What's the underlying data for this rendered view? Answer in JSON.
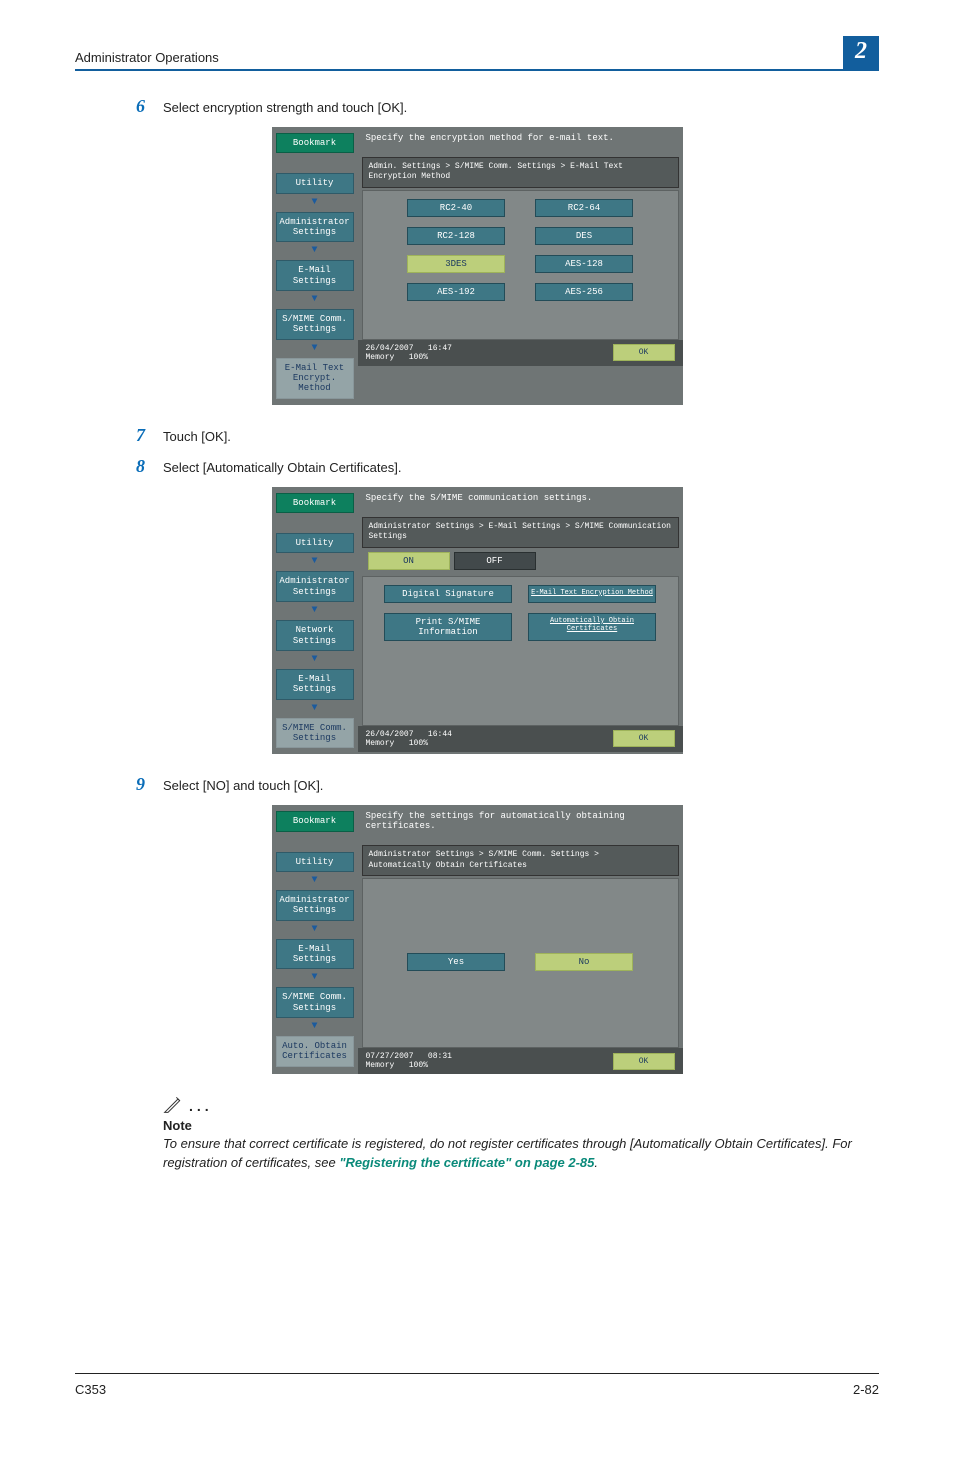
{
  "header": {
    "title": "Administrator Operations",
    "chapter_num": "2"
  },
  "steps": [
    {
      "num": "6",
      "text": "Select encryption strength and touch [OK]."
    },
    {
      "num": "7",
      "text": "Touch [OK]."
    },
    {
      "num": "8",
      "text": "Select [Automatically Obtain Certificates]."
    },
    {
      "num": "9",
      "text": "Select [NO] and touch [OK]."
    }
  ],
  "panel1": {
    "instruction": "Specify the encryption method for e-mail text.",
    "breadcrumb": "Admin. Settings > S/MIME Comm. Settings > E-Mail Text Encryption Method",
    "sidebar": {
      "bookmark": "Bookmark",
      "items": [
        "Utility",
        "Administrator Settings",
        "E-Mail Settings",
        "S/MIME Comm. Settings"
      ],
      "active": "E-Mail Text Encrypt. Method"
    },
    "options_rows": [
      [
        "RC2-40",
        "RC2-64"
      ],
      [
        "RC2-128",
        "DES"
      ],
      [
        "3DES",
        "AES-128"
      ],
      [
        "AES-192",
        "AES-256"
      ]
    ],
    "selected_row": 2,
    "selected_col": 0,
    "footer": {
      "date": "26/04/2007",
      "time": "16:47",
      "mem_label": "Memory",
      "mem_val": "100%",
      "ok": "OK"
    }
  },
  "panel2": {
    "instruction": "Specify the S/MIME communication settings.",
    "breadcrumb": "Administrator Settings > E-Mail Settings > S/MIME Communication Settings",
    "sidebar": {
      "bookmark": "Bookmark",
      "items": [
        "Utility",
        "Administrator Settings",
        "Network Settings",
        "E-Mail Settings"
      ],
      "active": "S/MIME Comm. Settings"
    },
    "onoff": {
      "on": "ON",
      "off": "OFF"
    },
    "pairs": [
      {
        "left": "Digital Signature",
        "right": "E-Mail Text Encryption Method"
      },
      {
        "left": "Print S/MIME Information",
        "right": "Automatically Obtain Certificates"
      }
    ],
    "footer": {
      "date": "26/04/2007",
      "time": "16:44",
      "mem_label": "Memory",
      "mem_val": "100%",
      "ok": "OK"
    }
  },
  "panel3": {
    "instruction": "Specify the settings for automatically obtaining certificates.",
    "breadcrumb": "Administrator Settings > S/MIME Comm. Settings >\nAutomatically Obtain Certificates",
    "sidebar": {
      "bookmark": "Bookmark",
      "items": [
        "Utility",
        "Administrator Settings",
        "E-Mail Settings",
        "S/MIME Comm. Settings"
      ],
      "active": "Auto. Obtain Certificates"
    },
    "yes": "Yes",
    "no": "No",
    "footer": {
      "date": "07/27/2007",
      "time": "08:31",
      "mem_label": "Memory",
      "mem_val": "100%",
      "ok": "OK"
    }
  },
  "note": {
    "heading": "Note",
    "text_before": "To ensure that correct certificate is registered, do not register certificates through [Automatically Obtain Certificates]. For registration of certificates, see ",
    "link": "\"Registering the certificate\" on page 2-85",
    "text_after": "."
  },
  "page_footer": {
    "left": "C353",
    "right": "2-82"
  }
}
